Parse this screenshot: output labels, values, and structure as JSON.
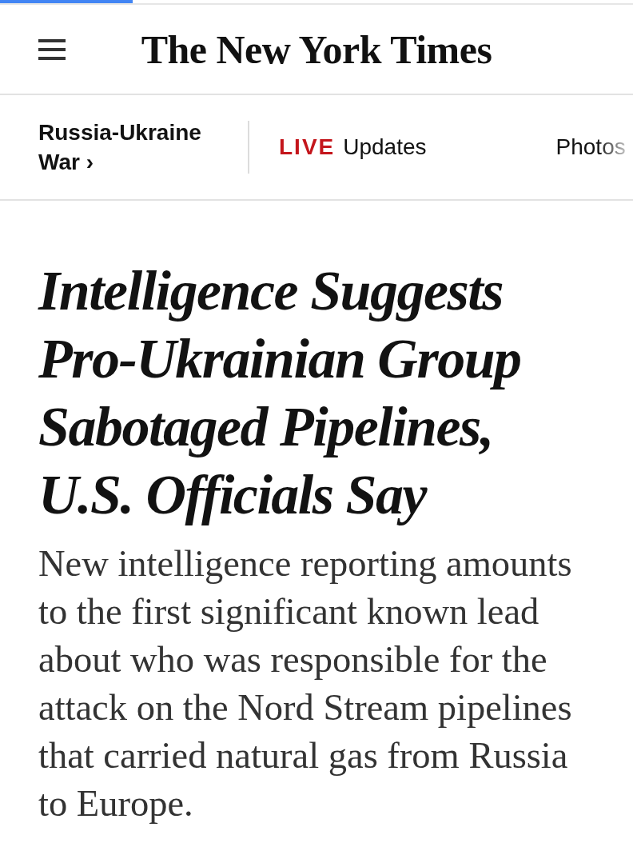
{
  "loading_bar": {
    "level": 0.21
  },
  "header": {
    "logo": "The New York Times"
  },
  "section_nav": {
    "section": "Russia-Ukraine War ›",
    "items": [
      {
        "kind": "live",
        "badge": "LIVE",
        "label": "Updates"
      },
      {
        "kind": "plain",
        "label": "Photos"
      }
    ]
  },
  "article": {
    "headline": "Intelligence Suggests Pro-Ukrainian Group Sabotaged Pipelines, U.S. Officials Say",
    "summary": "New intelligence reporting amounts to the first significant known lead about who was responsible for the attack on the Nord Stream pipelines that carried natural gas from Russia to Europe."
  }
}
